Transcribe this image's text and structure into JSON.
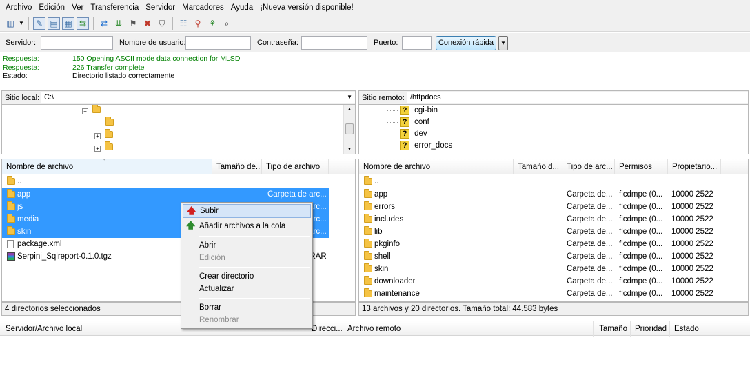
{
  "menu": [
    "Archivo",
    "Edición",
    "Ver",
    "Transferencia",
    "Servidor",
    "Marcadores",
    "Ayuda",
    "¡Nueva versión disponible!"
  ],
  "quickconnect": {
    "host_label": "Servidor:",
    "user_label": "Nombre de usuario:",
    "pass_label": "Contraseña:",
    "port_label": "Puerto:",
    "host_value": "",
    "user_value": "",
    "pass_value": "",
    "port_value": "",
    "button": "Conexión rápida",
    "dropdown_arrow": "▼"
  },
  "log": [
    {
      "key": "Respuesta:",
      "value": "150 Opening ASCII mode data connection for MLSD",
      "color": "#008000"
    },
    {
      "key": "Respuesta:",
      "value": "226 Transfer complete",
      "color": "#008000"
    },
    {
      "key": "Estado:",
      "value": "Directorio listado correctamente",
      "color": "#000000"
    }
  ],
  "local": {
    "site_label": "Sitio local:",
    "path": "C:\\",
    "columns": [
      "Nombre de archivo",
      "Tamaño de...",
      "Tipo de archivo"
    ],
    "files": [
      {
        "name": "..",
        "type": "",
        "selected": false,
        "icon": "folder-icon"
      },
      {
        "name": "app",
        "type": "Carpeta de arc...",
        "selected": true,
        "icon": "folder-icon"
      },
      {
        "name": "js",
        "type": "Carpeta de arc...",
        "selected": true,
        "icon": "folder-icon"
      },
      {
        "name": "media",
        "type": "Carpeta de arc...",
        "selected": true,
        "icon": "folder-icon"
      },
      {
        "name": "skin",
        "type": "Carpeta de arc...",
        "selected": true,
        "icon": "folder-icon"
      },
      {
        "name": "package.xml",
        "type": "",
        "selected": false,
        "icon": "document-icon"
      },
      {
        "name": "Serpini_Sqlreport-0.1.0.tgz",
        "type": "Archivo WinRAR",
        "selected": false,
        "icon": "archive-icon"
      }
    ],
    "status": "4 directorios seleccionados"
  },
  "remote": {
    "site_label": "Sitio remoto:",
    "path": "/httpdocs",
    "tree": [
      "cgi-bin",
      "conf",
      "dev",
      "error_docs"
    ],
    "columns": [
      "Nombre de archivo",
      "Tamaño d...",
      "Tipo de arc...",
      "Permisos",
      "Propietario..."
    ],
    "files": [
      {
        "name": "..",
        "type": "",
        "perm": "",
        "owner": ""
      },
      {
        "name": "app",
        "type": "Carpeta de...",
        "perm": "flcdmpe (0...",
        "owner": "10000 2522"
      },
      {
        "name": "errors",
        "type": "Carpeta de...",
        "perm": "flcdmpe (0...",
        "owner": "10000 2522"
      },
      {
        "name": "includes",
        "type": "Carpeta de...",
        "perm": "flcdmpe (0...",
        "owner": "10000 2522"
      },
      {
        "name": "lib",
        "type": "Carpeta de...",
        "perm": "flcdmpe (0...",
        "owner": "10000 2522"
      },
      {
        "name": "pkginfo",
        "type": "Carpeta de...",
        "perm": "flcdmpe (0...",
        "owner": "10000 2522"
      },
      {
        "name": "shell",
        "type": "Carpeta de...",
        "perm": "flcdmpe (0...",
        "owner": "10000 2522"
      },
      {
        "name": "skin",
        "type": "Carpeta de...",
        "perm": "flcdmpe (0...",
        "owner": "10000 2522"
      },
      {
        "name": "downloader",
        "type": "Carpeta de...",
        "perm": "flcdmpe (0...",
        "owner": "10000 2522"
      },
      {
        "name": "maintenance",
        "type": "Carpeta de...",
        "perm": "flcdmpe (0...",
        "owner": "10000 2522"
      }
    ],
    "status": "13 archivos y 20 directorios. Tamaño total: 44.583 bytes"
  },
  "queue": {
    "columns": [
      "Servidor/Archivo local",
      "Direcci...",
      "Archivo remoto",
      "Tamaño",
      "Prioridad",
      "Estado"
    ]
  },
  "context_menu": {
    "items": [
      {
        "label": "Subir",
        "highlighted": true,
        "disabled": false
      },
      {
        "label": "Añadir archivos a la cola",
        "highlighted": false,
        "disabled": false
      },
      {
        "label": "Abrir",
        "highlighted": false,
        "disabled": false
      },
      {
        "label": "Edición",
        "highlighted": false,
        "disabled": true
      },
      {
        "label": "Crear directorio",
        "highlighted": false,
        "disabled": false
      },
      {
        "label": "Actualizar",
        "highlighted": false,
        "disabled": false
      },
      {
        "label": "Borrar",
        "highlighted": false,
        "disabled": false
      },
      {
        "label": "Renombrar",
        "highlighted": false,
        "disabled": true
      }
    ]
  },
  "colors": {
    "selection": "#3399ff",
    "log_green": "#008000",
    "menu_highlight": "#d5e5f8"
  }
}
